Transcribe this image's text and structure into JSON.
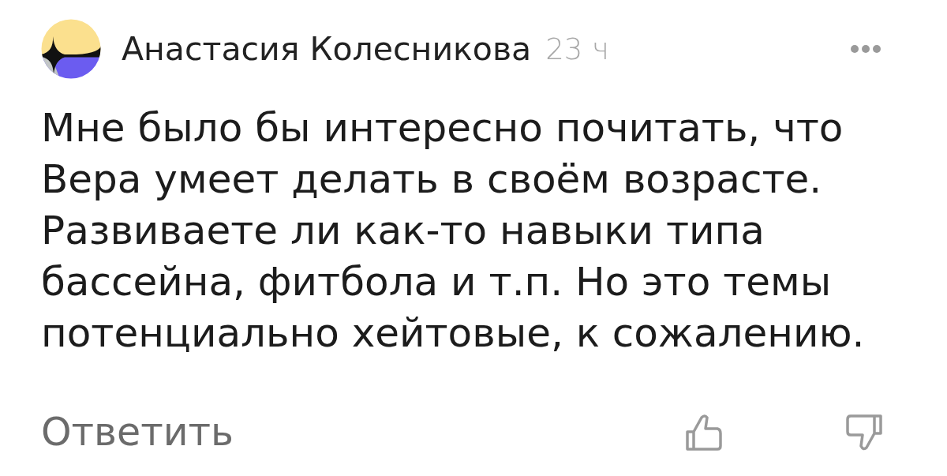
{
  "comment": {
    "author": "Анастасия Колесникова",
    "time": "23 ч",
    "text": "Мне было бы интересно почитать, что Вера умеет делать в своём возрасте. Развиваете ли как-то навыки типа бассейна, фитбола и т.п. Но это темы потенциально хейтовые, к сожалению.",
    "reply_label": "Ответить"
  }
}
